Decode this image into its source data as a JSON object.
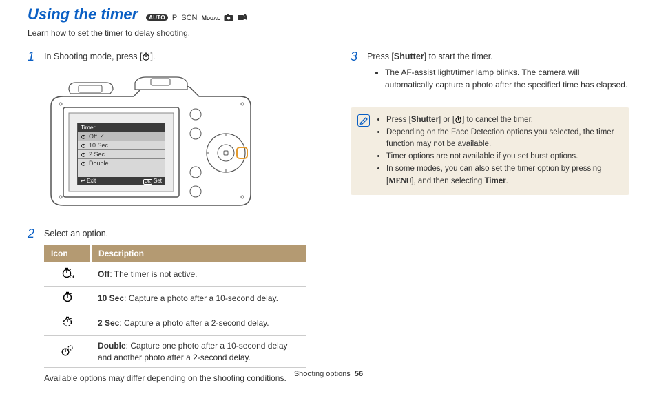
{
  "title": "Using the timer",
  "modes": {
    "auto": "AUTO",
    "p": "P",
    "scn": "SCN",
    "dual": "MDUAL"
  },
  "subtitle": "Learn how to set the timer to delay shooting.",
  "steps": {
    "s1_pre": "In Shooting mode, press [",
    "s1_post": "].",
    "s2": "Select an option.",
    "s3_pre": "Press [",
    "s3_btn": "Shutter",
    "s3_post": "] to start the timer.",
    "s3_bullet": "The AF-assist light/timer lamp blinks. The camera will automatically capture a photo after the specified time has elapsed."
  },
  "camera_menu": {
    "title": "Timer",
    "items": [
      "Off",
      "10 Sec",
      "2 Sec",
      "Double"
    ],
    "foot_left": "Exit",
    "foot_right": "Set",
    "foot_right_key": "OK",
    "foot_left_icon": "↩"
  },
  "table": {
    "head_icon": "Icon",
    "head_desc": "Description",
    "rows": [
      {
        "label_bold": "Off",
        "label_rest": ": The timer is not active."
      },
      {
        "label_bold": "10 Sec",
        "label_rest": ": Capture a photo after a 10-second delay."
      },
      {
        "label_bold": "2 Sec",
        "label_rest": ": Capture a photo after a 2-second delay."
      },
      {
        "label_bold": "Double",
        "label_rest": ": Capture one photo after a 10-second delay and another photo after a 2-second delay."
      }
    ],
    "note": "Available options may differ depending on the shooting conditions."
  },
  "notebox": {
    "b1_pre": "Press [",
    "b1_btn": "Shutter",
    "b1_mid": "] or [",
    "b1_post": "] to cancel the timer.",
    "b2": "Depending on the Face Detection options you selected, the timer function may not be available.",
    "b3": "Timer options are not available if you set burst options.",
    "b4_pre": "In some modes, you can also set the timer option by pressing [",
    "b4_menu": "MENU",
    "b4_mid": "], and then selecting ",
    "b4_bold": "Timer",
    "b4_post": "."
  },
  "footer": {
    "section": "Shooting options",
    "page": "56"
  }
}
